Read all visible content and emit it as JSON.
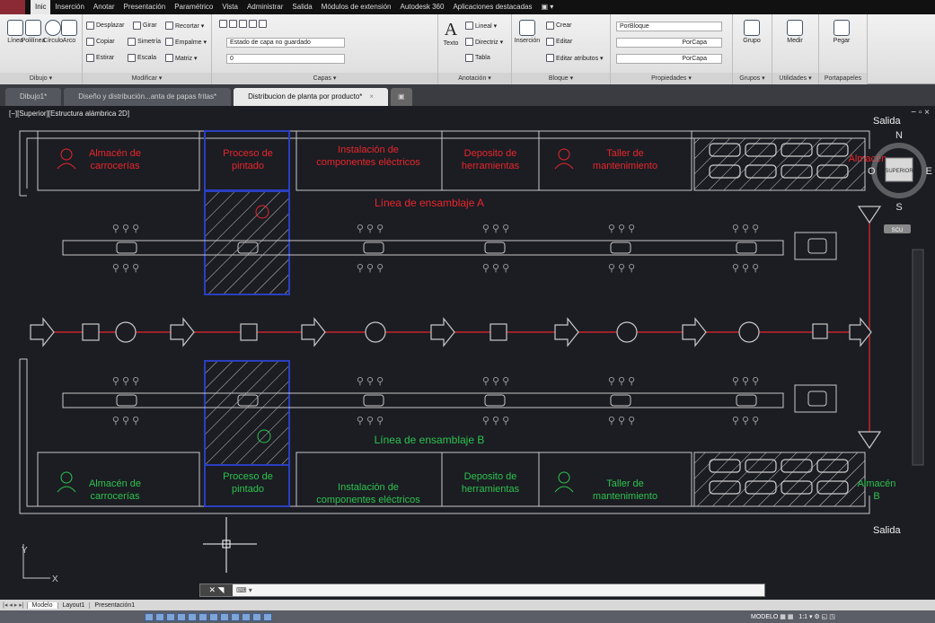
{
  "menu": {
    "items": [
      "Inic",
      "Inserción",
      "Anotar",
      "Presentación",
      "Paramétrico",
      "Vista",
      "Administrar",
      "Salida",
      "Módulos de extensión",
      "Autodesk 360",
      "Aplicaciones destacadas",
      "▣ ▾"
    ],
    "active": "Inic"
  },
  "ribbon": {
    "dibujo": {
      "title": "Dibujo ▾",
      "linea": "Línea",
      "polilinea": "Polilínea",
      "circulo": "Círculo",
      "arco": "Arco"
    },
    "modificar": {
      "title": "Modificar ▾",
      "desplazar": "Desplazar",
      "girar": "Girar",
      "recortar": "Recortar ▾",
      "copiar": "Copiar",
      "simetria": "Simetría",
      "empalme": "Empalme ▾",
      "estirar": "Estirar",
      "escala": "Escala",
      "matriz": "Matriz ▾"
    },
    "capas": {
      "title": "Capas ▾",
      "estado": "Estado de capa no guardado",
      "layer": "0"
    },
    "anotacion": {
      "title": "Anotación ▾",
      "texto": "Texto",
      "lineal": "Lineal ▾",
      "directriz": "Directriz ▾",
      "tabla": "Tabla"
    },
    "bloque": {
      "title": "Bloque ▾",
      "insercion": "Inserción",
      "crear": "Crear",
      "editar": "Editar",
      "editar_atributos": "Editar atributos ▾"
    },
    "propiedades": {
      "title": "Propiedades ▾",
      "porbloque": "PorBloque",
      "porcapa1": "PorCapa",
      "porcapa2": "PorCapa"
    },
    "grupos": {
      "title": "Grupos ▾",
      "grupo": "Grupo"
    },
    "utilidades": {
      "title": "Utilidades ▾",
      "medir": "Medir"
    },
    "portapapeles": {
      "title": "Portapapeles",
      "pegar": "Pegar"
    }
  },
  "doc_tabs": [
    {
      "label": "Dibujo1*"
    },
    {
      "label": "Diseño y distribución...anta de papas fritas*"
    },
    {
      "label": "Distribucion de planta por producto*"
    }
  ],
  "doc_tab_close": "×",
  "viewport_label": "[−][Superior][Estructura alámbrica 2D]",
  "viewport_controls": "− ▫ ×",
  "drawing": {
    "top_rooms": [
      "Almacén de carrocerías",
      "Proceso de pintado",
      "Instalación de componentes eléctricos",
      "Deposito de herramientas",
      "Taller de mantenimiento",
      "Almacén"
    ],
    "bottom_rooms": [
      "Almacén de carrocerías",
      "Proceso de pintado",
      "Instalación de componentes eléctricos",
      "Deposito de herramientas",
      "Taller de mantenimiento",
      "Almacén B"
    ],
    "line_a": "Línea de ensamblaje A",
    "line_b": "Línea de ensamblaje B",
    "salida_top": "Salida",
    "salida_bottom": "Salida",
    "compass": {
      "n": "N",
      "s": "S",
      "e": "E",
      "o": "O",
      "face": "SUPERIOR",
      "scu": "SCU"
    },
    "ucs": {
      "x": "X",
      "y": "Y"
    },
    "colors": {
      "red": "#e8262b",
      "green": "#2ec24d",
      "blue": "#2b3fc0",
      "line": "#c8c8c8"
    }
  },
  "cmdline": {
    "prompt": "⌨ ▾"
  },
  "layout_tabs": [
    "Modelo",
    "Layout1",
    "Presentación1"
  ],
  "layout_nav": "|◂ ◂ ▸ ▸|",
  "status": {
    "mode": "MODELO",
    "scale": "1:1"
  }
}
